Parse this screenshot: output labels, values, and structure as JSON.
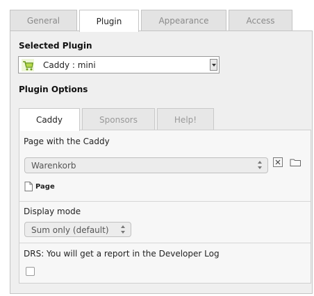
{
  "tabs": [
    "General",
    "Plugin",
    "Appearance",
    "Access"
  ],
  "selected_plugin": {
    "title": "Selected Plugin",
    "value": "Caddy : mini",
    "icon": "shopping-cart-icon"
  },
  "plugin_options": {
    "title": "Plugin Options",
    "tabs": [
      "Caddy",
      "Sponsors",
      "Help!"
    ]
  },
  "page_with_caddy": {
    "label": "Page with the Caddy",
    "select_value": "Warenkorb",
    "link_label": "Page"
  },
  "display_mode": {
    "label": "Display mode",
    "select_value": "Sum only (default)"
  },
  "drs": {
    "label": "DRS: You will get a report in the Developer Log",
    "checked": false
  }
}
